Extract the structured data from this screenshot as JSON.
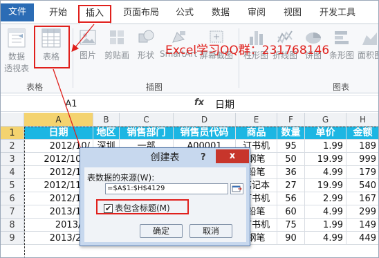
{
  "tabs": [
    "文件",
    "开始",
    "插入",
    "页面布局",
    "公式",
    "数据",
    "审阅",
    "视图",
    "开发工具"
  ],
  "ribbon": {
    "buttons": {
      "pivot": "数据透视表",
      "pivot_line1": "数据",
      "pivot_line2": "透视表",
      "table": "表格",
      "picture": "图片",
      "clipart": "剪贴画",
      "shapes": "形状",
      "smartart": "SmartArt",
      "screenshot": "屏幕截图",
      "column": "柱形图",
      "line": "折线图",
      "pie": "饼图",
      "bar": "条形图",
      "area": "面积图"
    },
    "groups": {
      "tables": "表格",
      "illustrations": "插图",
      "charts": "图表"
    },
    "watermark": "Excel学习QQ群：231768146"
  },
  "formula_bar": {
    "namebox": "A1",
    "fx": "fx",
    "content": "日期"
  },
  "grid": {
    "columns": [
      "A",
      "B",
      "C",
      "D",
      "E",
      "F",
      "G",
      "H"
    ],
    "rows": [
      "1",
      "2",
      "3",
      "4",
      "5",
      "6",
      "7",
      "8",
      "9"
    ],
    "header": [
      "日期",
      "地区",
      "销售部门",
      "销售员代码",
      "商品",
      "数量",
      "单价",
      "金额"
    ],
    "data": [
      [
        "2012/10/",
        "深圳",
        "一部",
        "A00001",
        "订书机",
        "95",
        "1.99",
        "189"
      ],
      [
        "2012/10/2",
        "",
        "",
        "",
        "钢笔",
        "50",
        "19.99",
        "999"
      ],
      [
        "2012/11/",
        "",
        "",
        "",
        "铅笔",
        "36",
        "4.99",
        "179"
      ],
      [
        "2012/11/2",
        "",
        "",
        "",
        "笔记本",
        "27",
        "19.99",
        "540"
      ],
      [
        "2012/12/",
        "",
        "",
        "",
        "订书机",
        "56",
        "2.99",
        "167"
      ],
      [
        "2013/1/1",
        "",
        "",
        "",
        "铅笔",
        "60",
        "4.99",
        "299"
      ],
      [
        "2013/1/",
        "",
        "",
        "",
        "订书机",
        "75",
        "1.99",
        "149"
      ],
      [
        "2013/2/4",
        "广州",
        "二部",
        "A00002",
        "钢笔",
        "90",
        "4.99",
        "449"
      ]
    ]
  },
  "dialog": {
    "title": "创建表",
    "help": "?",
    "close": "x",
    "source_label": "表数据的来源(W):",
    "range": "=$A$1:$H$4129",
    "has_headers_label": "表包含标题(M)",
    "has_headers_checked": "✔",
    "ok": "确定",
    "cancel": "取消"
  },
  "colors": {
    "file_tab": "#2b6cb5",
    "header_fill": "#1cb6e3",
    "highlight": "#e0201c",
    "selection": "#f4d36f"
  }
}
